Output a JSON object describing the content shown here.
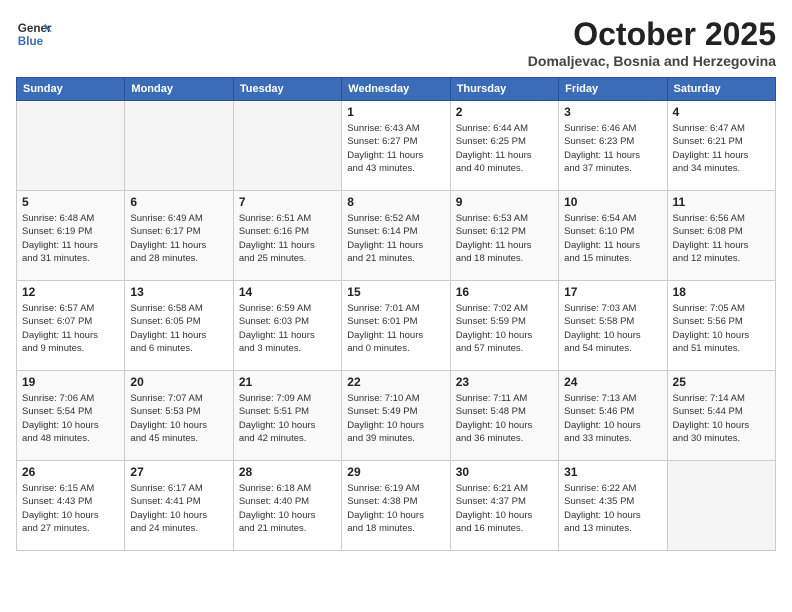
{
  "header": {
    "logo_line1": "General",
    "logo_line2": "Blue",
    "month": "October 2025",
    "location": "Domaljevac, Bosnia and Herzegovina"
  },
  "weekdays": [
    "Sunday",
    "Monday",
    "Tuesday",
    "Wednesday",
    "Thursday",
    "Friday",
    "Saturday"
  ],
  "weeks": [
    [
      {
        "day": "",
        "info": ""
      },
      {
        "day": "",
        "info": ""
      },
      {
        "day": "",
        "info": ""
      },
      {
        "day": "1",
        "info": "Sunrise: 6:43 AM\nSunset: 6:27 PM\nDaylight: 11 hours\nand 43 minutes."
      },
      {
        "day": "2",
        "info": "Sunrise: 6:44 AM\nSunset: 6:25 PM\nDaylight: 11 hours\nand 40 minutes."
      },
      {
        "day": "3",
        "info": "Sunrise: 6:46 AM\nSunset: 6:23 PM\nDaylight: 11 hours\nand 37 minutes."
      },
      {
        "day": "4",
        "info": "Sunrise: 6:47 AM\nSunset: 6:21 PM\nDaylight: 11 hours\nand 34 minutes."
      }
    ],
    [
      {
        "day": "5",
        "info": "Sunrise: 6:48 AM\nSunset: 6:19 PM\nDaylight: 11 hours\nand 31 minutes."
      },
      {
        "day": "6",
        "info": "Sunrise: 6:49 AM\nSunset: 6:17 PM\nDaylight: 11 hours\nand 28 minutes."
      },
      {
        "day": "7",
        "info": "Sunrise: 6:51 AM\nSunset: 6:16 PM\nDaylight: 11 hours\nand 25 minutes."
      },
      {
        "day": "8",
        "info": "Sunrise: 6:52 AM\nSunset: 6:14 PM\nDaylight: 11 hours\nand 21 minutes."
      },
      {
        "day": "9",
        "info": "Sunrise: 6:53 AM\nSunset: 6:12 PM\nDaylight: 11 hours\nand 18 minutes."
      },
      {
        "day": "10",
        "info": "Sunrise: 6:54 AM\nSunset: 6:10 PM\nDaylight: 11 hours\nand 15 minutes."
      },
      {
        "day": "11",
        "info": "Sunrise: 6:56 AM\nSunset: 6:08 PM\nDaylight: 11 hours\nand 12 minutes."
      }
    ],
    [
      {
        "day": "12",
        "info": "Sunrise: 6:57 AM\nSunset: 6:07 PM\nDaylight: 11 hours\nand 9 minutes."
      },
      {
        "day": "13",
        "info": "Sunrise: 6:58 AM\nSunset: 6:05 PM\nDaylight: 11 hours\nand 6 minutes."
      },
      {
        "day": "14",
        "info": "Sunrise: 6:59 AM\nSunset: 6:03 PM\nDaylight: 11 hours\nand 3 minutes."
      },
      {
        "day": "15",
        "info": "Sunrise: 7:01 AM\nSunset: 6:01 PM\nDaylight: 11 hours\nand 0 minutes."
      },
      {
        "day": "16",
        "info": "Sunrise: 7:02 AM\nSunset: 5:59 PM\nDaylight: 10 hours\nand 57 minutes."
      },
      {
        "day": "17",
        "info": "Sunrise: 7:03 AM\nSunset: 5:58 PM\nDaylight: 10 hours\nand 54 minutes."
      },
      {
        "day": "18",
        "info": "Sunrise: 7:05 AM\nSunset: 5:56 PM\nDaylight: 10 hours\nand 51 minutes."
      }
    ],
    [
      {
        "day": "19",
        "info": "Sunrise: 7:06 AM\nSunset: 5:54 PM\nDaylight: 10 hours\nand 48 minutes."
      },
      {
        "day": "20",
        "info": "Sunrise: 7:07 AM\nSunset: 5:53 PM\nDaylight: 10 hours\nand 45 minutes."
      },
      {
        "day": "21",
        "info": "Sunrise: 7:09 AM\nSunset: 5:51 PM\nDaylight: 10 hours\nand 42 minutes."
      },
      {
        "day": "22",
        "info": "Sunrise: 7:10 AM\nSunset: 5:49 PM\nDaylight: 10 hours\nand 39 minutes."
      },
      {
        "day": "23",
        "info": "Sunrise: 7:11 AM\nSunset: 5:48 PM\nDaylight: 10 hours\nand 36 minutes."
      },
      {
        "day": "24",
        "info": "Sunrise: 7:13 AM\nSunset: 5:46 PM\nDaylight: 10 hours\nand 33 minutes."
      },
      {
        "day": "25",
        "info": "Sunrise: 7:14 AM\nSunset: 5:44 PM\nDaylight: 10 hours\nand 30 minutes."
      }
    ],
    [
      {
        "day": "26",
        "info": "Sunrise: 6:15 AM\nSunset: 4:43 PM\nDaylight: 10 hours\nand 27 minutes."
      },
      {
        "day": "27",
        "info": "Sunrise: 6:17 AM\nSunset: 4:41 PM\nDaylight: 10 hours\nand 24 minutes."
      },
      {
        "day": "28",
        "info": "Sunrise: 6:18 AM\nSunset: 4:40 PM\nDaylight: 10 hours\nand 21 minutes."
      },
      {
        "day": "29",
        "info": "Sunrise: 6:19 AM\nSunset: 4:38 PM\nDaylight: 10 hours\nand 18 minutes."
      },
      {
        "day": "30",
        "info": "Sunrise: 6:21 AM\nSunset: 4:37 PM\nDaylight: 10 hours\nand 16 minutes."
      },
      {
        "day": "31",
        "info": "Sunrise: 6:22 AM\nSunset: 4:35 PM\nDaylight: 10 hours\nand 13 minutes."
      },
      {
        "day": "",
        "info": ""
      }
    ]
  ]
}
